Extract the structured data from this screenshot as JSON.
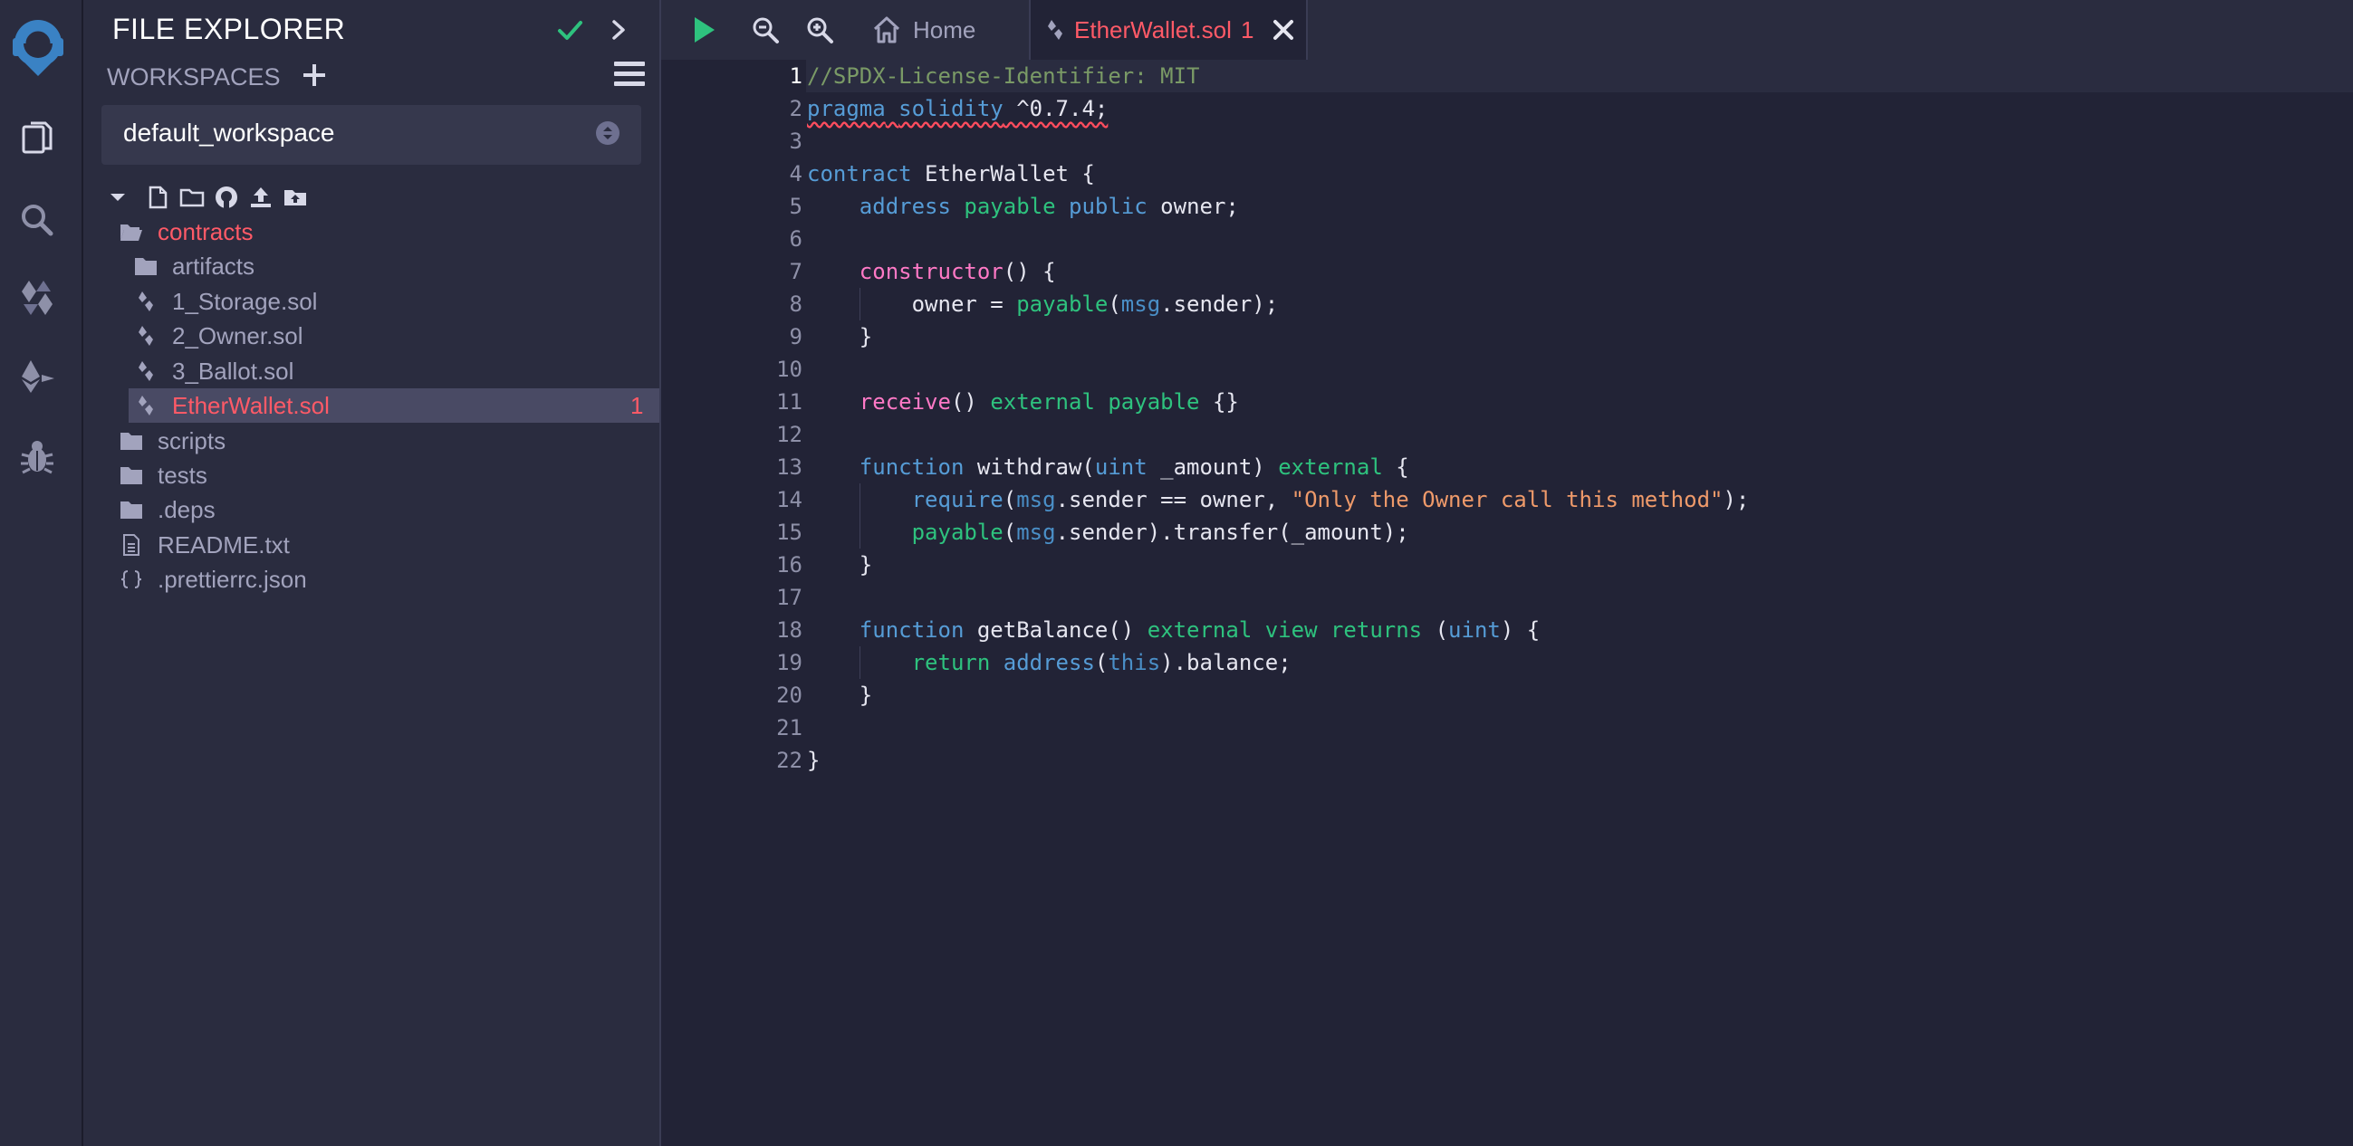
{
  "rail": {
    "items": [
      "remix-logo-icon",
      "file-explorer-icon",
      "search-icon",
      "solidity-compiler-icon",
      "deploy-run-icon",
      "debugger-icon"
    ]
  },
  "panel": {
    "title": "FILE EXPLORER",
    "workspaces_label": "WORKSPACES",
    "workspace_value": "default_workspace",
    "tree": [
      {
        "label": "contracts",
        "type": "folder-open",
        "active_color": "#ff5a67"
      },
      {
        "label": "artifacts",
        "type": "folder"
      },
      {
        "label": "1_Storage.sol",
        "type": "solidity"
      },
      {
        "label": "2_Owner.sol",
        "type": "solidity"
      },
      {
        "label": "3_Ballot.sol",
        "type": "solidity"
      },
      {
        "label": "EtherWallet.sol",
        "type": "solidity",
        "badge": "1"
      },
      {
        "label": "scripts",
        "type": "folder"
      },
      {
        "label": "tests",
        "type": "folder"
      },
      {
        "label": ".deps",
        "type": "folder"
      },
      {
        "label": "README.txt",
        "type": "file"
      },
      {
        "label": ".prettierrc.json",
        "type": "json"
      }
    ]
  },
  "tabs": {
    "home": "Home",
    "file": "EtherWallet.sol",
    "file_badge": "1"
  },
  "editor": {
    "line_numbers": [
      "1",
      "2",
      "3",
      "4",
      "5",
      "6",
      "7",
      "8",
      "9",
      "10",
      "11",
      "12",
      "13",
      "14",
      "15",
      "16",
      "17",
      "18",
      "19",
      "20",
      "21",
      "22"
    ],
    "lines": [
      "//SPDX-License-Identifier: MIT",
      "pragma solidity ^0.7.4;",
      "",
      "contract EtherWallet {",
      "    address payable public owner;",
      "",
      "    constructor() {",
      "        owner = payable(msg.sender);",
      "    }",
      "",
      "    receive() external payable {}",
      "",
      "    function withdraw(uint _amount) external {",
      "        require(msg.sender == owner, \"Only the Owner call this method\");",
      "        payable(msg.sender).transfer(_amount);",
      "    }",
      "",
      "    function getBalance() external view returns (uint) {",
      "        return address(this).balance;",
      "    }",
      "",
      "}"
    ]
  },
  "colors": {
    "accent_red": "#ff5a67",
    "run_green": "#2ec27e",
    "background": "#222336",
    "panel": "#2a2c3f"
  }
}
